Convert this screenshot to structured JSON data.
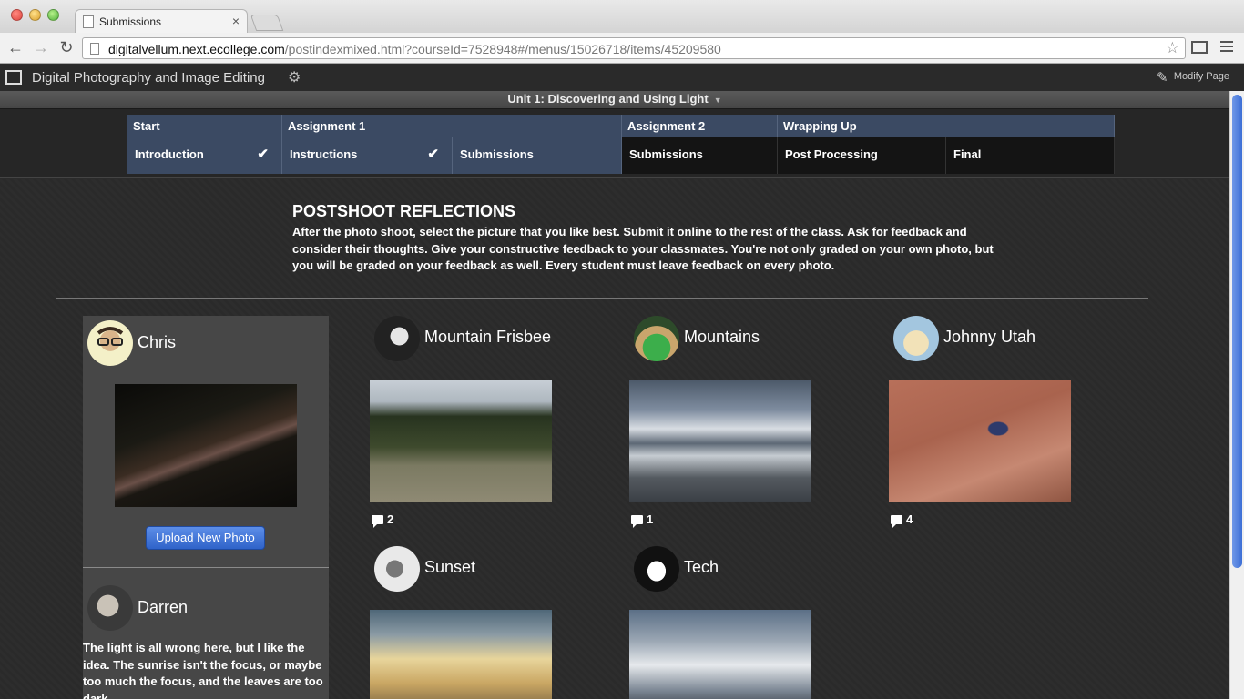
{
  "browser": {
    "tab_title": "Submissions",
    "tab_close": "×",
    "url_host": "digitalvellum.next.ecollege.com",
    "url_path": "/postindexmixed.html?courseId=7528948#/menus/15026718/items/45209580",
    "back_icon": "←",
    "forward_icon": "→",
    "reload_icon": "↻",
    "star_icon": "☆"
  },
  "app": {
    "course_title": "Digital Photography and Image Editing",
    "gear_icon": "⚙",
    "modify_label": "Modify Page",
    "pencil_icon": "✎",
    "unit_label": "Unit 1: Discovering and Using Light",
    "unit_caret": "▼"
  },
  "nav": {
    "sections": [
      {
        "label": "Start"
      },
      {
        "label": "Assignment 1"
      },
      {
        "label": "Assignment 2"
      },
      {
        "label": "Wrapping Up"
      }
    ],
    "items": [
      {
        "label": "Introduction",
        "check": "✔"
      },
      {
        "label": "Instructions",
        "check": "✔"
      },
      {
        "label": "Submissions"
      },
      {
        "label": "Submissions"
      },
      {
        "label": "Post Processing"
      },
      {
        "label": "Final"
      }
    ]
  },
  "content": {
    "heading": "POSTSHOOT REFLECTIONS",
    "intro": "After the photo shoot, select the picture that you like best. Submit it online to the rest of the class. Ask for feedback and consider their thoughts. Give your constructive feedback to your classmates. You're not only graded on your own photo, but you will be graded on your feedback as well. Every student must leave feedback on every photo."
  },
  "panel": {
    "user_name": "Chris",
    "upload_label": "Upload New Photo",
    "commenter_name": "Darren",
    "feedback_text": "The light is all wrong here, but I like the idea. The sunrise isn't the focus, or maybe too much the focus, and the leaves are too dark."
  },
  "submissions": [
    {
      "title": "Mountain Frisbee",
      "comments": "2"
    },
    {
      "title": "Mountains",
      "comments": "1"
    },
    {
      "title": "Johnny Utah",
      "comments": "4"
    },
    {
      "title": "Sunset"
    },
    {
      "title": "Tech"
    }
  ]
}
